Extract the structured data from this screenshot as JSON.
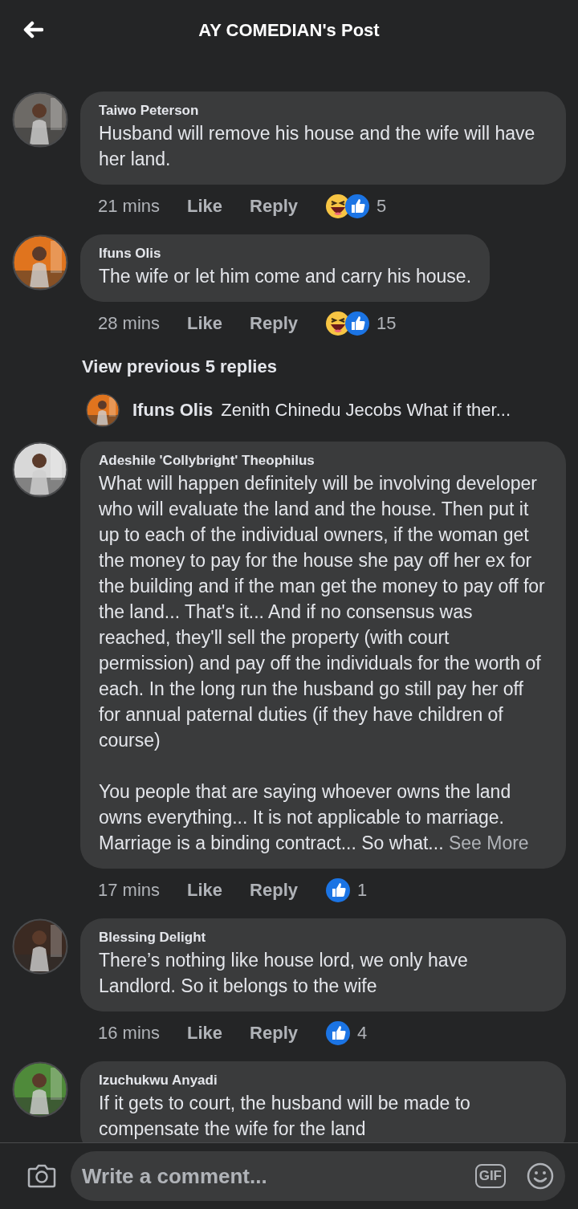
{
  "header": {
    "title": "AY COMEDIAN's Post"
  },
  "items": [
    {
      "kind": "comment",
      "author": "Taiwo Peterson",
      "paragraphs": [
        "Husband will remove his house and the wife will have her land."
      ],
      "time": "21 mins",
      "like": "Like",
      "reply": "Reply",
      "reactions": [
        {
          "kind": "haha"
        },
        {
          "kind": "like"
        }
      ],
      "count": "5"
    },
    {
      "kind": "comment",
      "author": "Ifuns Olis",
      "paragraphs": [
        "The wife or let him come and carry his house."
      ],
      "time": "28 mins",
      "like": "Like",
      "reply": "Reply",
      "reactions": [
        {
          "kind": "haha"
        },
        {
          "kind": "like"
        }
      ],
      "count": "15"
    },
    {
      "kind": "more",
      "label": "View previous 5 replies"
    },
    {
      "kind": "reply_preview",
      "author": "Ifuns Olis",
      "text": "Zenith Chinedu Jecobs What if ther..."
    },
    {
      "kind": "comment",
      "author": "Adeshile 'Collybright' Theophilus",
      "paragraphs": [
        "What will happen definitely will be involving developer who will evaluate the land and the house. Then put it up to each of the individual owners, if the woman get the money to pay for the house she pay off her ex for the building and if the man get the money to pay off for the land... That's it... And if no consensus was reached, they'll sell the property (with court permission) and pay off the individuals for the worth of each. In the long run the husband go still pay her off for annual paternal duties (if they have children of course)",
        "You people that are saying whoever owns the land owns everything... It is not applicable to marriage. Marriage is a binding contract... So what..."
      ],
      "see_more": "See More",
      "time": "17 mins",
      "like": "Like",
      "reply": "Reply",
      "reactions": [
        {
          "kind": "like"
        }
      ],
      "count": "1"
    },
    {
      "kind": "comment",
      "author": "Blessing Delight",
      "paragraphs": [
        "There’s nothing like house lord, we only have Landlord. So it belongs to the wife"
      ],
      "time": "16 mins",
      "like": "Like",
      "reply": "Reply",
      "reactions": [
        {
          "kind": "like"
        }
      ],
      "count": "4"
    },
    {
      "kind": "comment",
      "author": "Izuchukwu Anyadi",
      "paragraphs": [
        "If it gets to court, the husband will be made to compensate the wife for the land"
      ]
    }
  ],
  "composer": {
    "placeholder": "Write a comment...",
    "gif": "GIF"
  }
}
